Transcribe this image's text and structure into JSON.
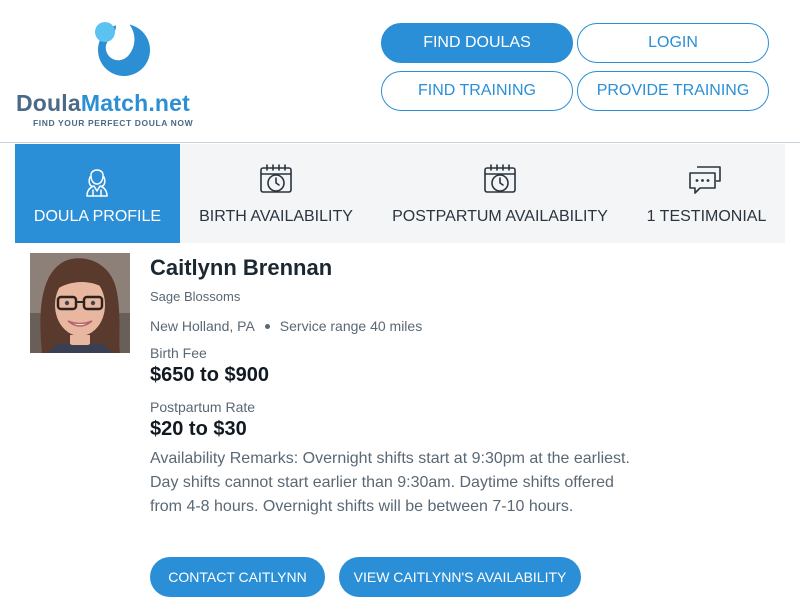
{
  "brand": {
    "name_part1": "Doula",
    "name_part2": "Match.net",
    "tagline": "FIND YOUR PERFECT DOULA NOW",
    "primary_color": "#2a8fd6",
    "dark_color": "#4a6a87",
    "logo_icon": "droplet-logo-icon"
  },
  "nav": {
    "find_doulas": "FIND DOULAS",
    "login": "LOGIN",
    "find_training": "FIND TRAINING",
    "provide_training": "PROVIDE TRAINING"
  },
  "tabs": [
    {
      "label": "DOULA PROFILE",
      "icon": "doula-person-icon",
      "active": true
    },
    {
      "label": "BIRTH AVAILABILITY",
      "icon": "calendar-clock-icon",
      "active": false
    },
    {
      "label": "POSTPARTUM AVAILABILITY",
      "icon": "calendar-clock-icon",
      "active": false
    },
    {
      "label": "1 TESTIMONIAL",
      "icon": "chat-bubbles-icon",
      "active": false
    }
  ],
  "profile": {
    "name": "Caitlynn Brennan",
    "practice": "Sage Blossoms",
    "location": "New Holland, PA",
    "service_range": "Service range 40 miles",
    "birth_fee_label": "Birth Fee",
    "birth_fee_value": "$650 to $900",
    "postpartum_label": "Postpartum Rate",
    "postpartum_value": "$20 to $30",
    "remarks": "Availability Remarks: Overnight shifts start at 9:30pm at the earliest. Day shifts cannot start earlier than 9:30am. Daytime shifts offered from 4-8 hours. Overnight shifts will be between 7-10 hours."
  },
  "actions": {
    "contact": "CONTACT CAITLYNN",
    "view_availability": "VIEW CAITLYNN'S AVAILABILITY"
  }
}
